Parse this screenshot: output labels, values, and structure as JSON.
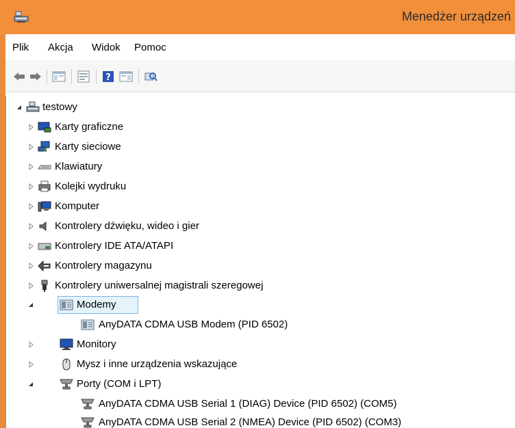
{
  "window": {
    "title": "Menedżer urządzeń"
  },
  "menu": [
    "Plik",
    "Akcja",
    "Widok",
    "Pomoc"
  ],
  "toolbar": {
    "buttons": [
      "back-arrow-icon",
      "forward-arrow-icon",
      "show-hide-console-tree-icon",
      "properties-icon",
      "help-icon",
      "action-pane-icon",
      "scan-hardware-icon"
    ]
  },
  "tree": {
    "root": "testowy",
    "categories": [
      {
        "label": "Karty graficzne",
        "icon": "display-adapter-icon"
      },
      {
        "label": "Karty sieciowe",
        "icon": "network-adapter-icon"
      },
      {
        "label": "Klawiatury",
        "icon": "keyboard-icon"
      },
      {
        "label": "Kolejki wydruku",
        "icon": "printer-icon"
      },
      {
        "label": "Komputer",
        "icon": "computer-icon"
      },
      {
        "label": "Kontrolery dźwięku, wideo i gier",
        "icon": "speaker-icon"
      },
      {
        "label": "Kontrolery IDE ATA/ATAPI",
        "icon": "ide-controller-icon"
      },
      {
        "label": "Kontrolery magazynu",
        "icon": "storage-controller-icon"
      },
      {
        "label": "Kontrolery uniwersalnej magistrali szeregowej",
        "icon": "usb-icon"
      },
      {
        "label": "Modemy",
        "icon": "modem-icon",
        "expanded": true,
        "selected": true,
        "children": [
          "AnyDATA CDMA USB Modem (PID 6502)"
        ]
      },
      {
        "label": "Monitory",
        "icon": "monitor-icon"
      },
      {
        "label": "Mysz i inne urządzenia wskazujące",
        "icon": "mouse-icon"
      },
      {
        "label": "Porty (COM i LPT)",
        "icon": "port-icon",
        "expanded": true,
        "children": [
          "AnyDATA CDMA USB Serial 1 (DIAG) Device (PID 6502) (COM5)",
          "AnyDATA CDMA USB Serial 2 (NMEA) Device (PID 6502) (COM3)"
        ]
      }
    ]
  },
  "colors": {
    "titlebar": "#f28f3b",
    "selection_bg": "#e5f3fb",
    "selection_border": "#7eb4ea"
  }
}
